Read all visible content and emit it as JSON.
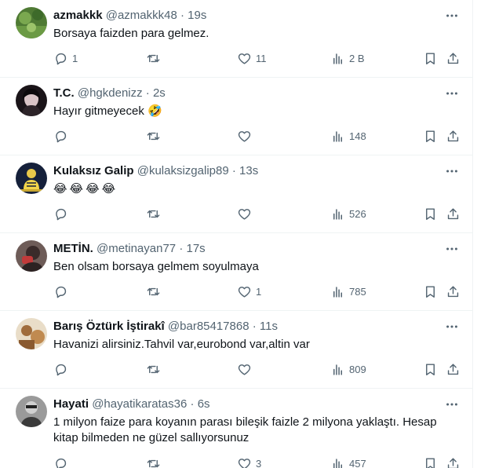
{
  "tweets": [
    {
      "name": "azmakkk",
      "handle": "@azmakkk48",
      "sep": "·",
      "time": "19s",
      "text": "Borsaya faizden para gelmez.",
      "replies": "1",
      "retweets": "",
      "likes": "11",
      "views": "2 B",
      "avatar_color": "#5a8a3c"
    },
    {
      "name": "T.C.",
      "handle": "@hgkdenizz",
      "sep": "·",
      "time": "2s",
      "text": "Hayır gitmeyecek 🤣",
      "replies": "",
      "retweets": "",
      "likes": "",
      "views": "148",
      "avatar_color": "#2a1f24"
    },
    {
      "name": "Kulaksız Galip",
      "handle": "@kulaksizgalip89",
      "sep": "·",
      "time": "13s",
      "emojis": [
        "😂",
        "😂",
        "😂",
        "😂"
      ],
      "replies": "",
      "retweets": "",
      "likes": "",
      "views": "526",
      "avatar_color": "#1d2b4a"
    },
    {
      "name": "METİN.",
      "handle": "@metinayan77",
      "sep": "·",
      "time": "17s",
      "text": "Ben olsam borsaya gelmem soyulmaya",
      "replies": "",
      "retweets": "",
      "likes": "1",
      "views": "785",
      "avatar_color": "#5b4a48"
    },
    {
      "name": "Barış Öztürk İştirakî",
      "handle": "@bar85417868",
      "sep": "·",
      "time": "11s",
      "text": "Havanizi alirsiniz.Tahvil var,eurobond var,altin var",
      "replies": "",
      "retweets": "",
      "likes": "",
      "views": "809",
      "avatar_color": "#b88a5a"
    },
    {
      "name": "Hayati",
      "handle": "@hayatikaratas36",
      "sep": "·",
      "time": "6s",
      "text": "1 milyon faize para koyanın parası bileşik faizle 2 milyona yaklaştı. Hesap kitap bilmeden ne güzel sallıyorsunuz",
      "replies": "",
      "retweets": "",
      "likes": "3",
      "views": "457",
      "avatar_color": "#8a8a8a"
    }
  ],
  "colors": {
    "text_primary": "#0f1419",
    "text_secondary": "#536471",
    "divider": "#eff3f4"
  },
  "icons": {
    "more": "more-dots-icon",
    "reply": "reply-bubble-icon",
    "retweet": "retweet-icon",
    "like": "heart-icon",
    "views": "bar-chart-icon",
    "bookmark": "bookmark-icon",
    "share": "share-upload-icon"
  }
}
